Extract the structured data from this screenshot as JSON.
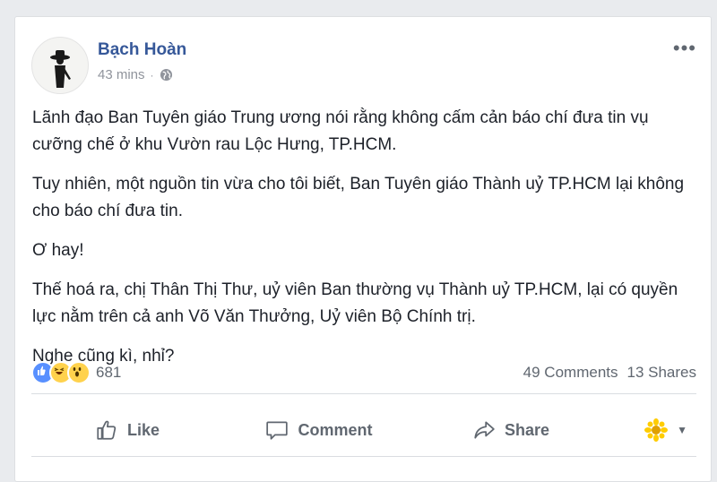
{
  "post": {
    "author": "Bạch Hoàn",
    "time": "43 mins",
    "separator": "·",
    "paragraphs": [
      "Lãnh đạo Ban Tuyên giáo Trung ương nói rằng không cấm cản báo chí đưa tin vụ cưỡng chế ở khu Vườn rau Lộc Hưng, TP.HCM.",
      "Tuy nhiên, một nguồn tin vừa cho tôi biết, Ban Tuyên giáo Thành uỷ TP.HCM lại không cho báo chí đưa tin.",
      "Ơ hay!",
      "Thế hoá ra, chị Thân Thị Thư, uỷ viên Ban thường vụ Thành uỷ TP.HCM, lại có quyền lực nằm trên cả anh Võ Văn Thưởng, Uỷ viên Bộ Chính trị.",
      "Nghe cũng kì, nhỉ?"
    ]
  },
  "stats": {
    "reaction_count": "681",
    "comments": "49 Comments",
    "shares": "13 Shares",
    "reactions": [
      "like-icon",
      "haha-icon",
      "wow-icon"
    ]
  },
  "actions": {
    "like": "Like",
    "comment": "Comment",
    "share": "Share"
  },
  "colors": {
    "author": "#365899",
    "muted": "#90949c",
    "like_blue": "#5890ff",
    "emoji_yellow": "#ffd24d"
  }
}
